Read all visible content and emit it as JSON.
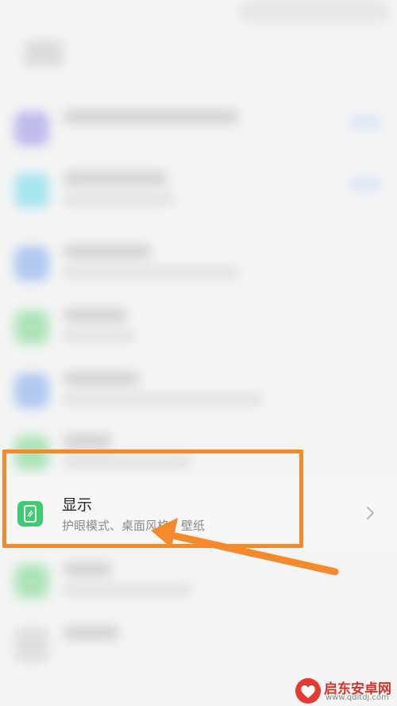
{
  "display_item": {
    "title": "显示",
    "subtitle": "护眼模式、桌面风格、壁纸",
    "icon": "display-phone-icon",
    "icon_color": "#3ecb72"
  },
  "annotation": {
    "box_color": "#f48a2c",
    "arrow_color": "#f48a2c"
  },
  "watermark": {
    "name": "启东安卓网",
    "url": "www.qdltdj.com",
    "logo_icon": "heart-logo-icon"
  }
}
